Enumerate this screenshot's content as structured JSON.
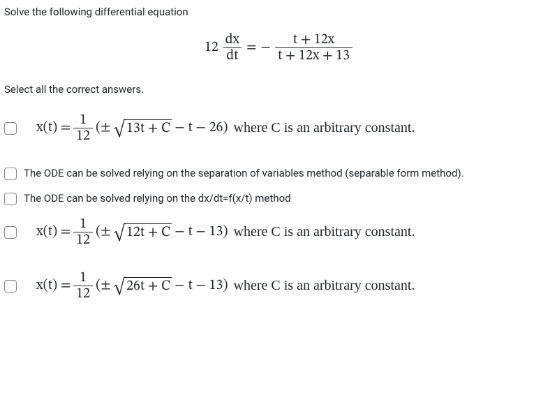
{
  "prompt": "Solve the following differential equation",
  "equation": {
    "lhs_coeff": "12",
    "lhs_num": "dx",
    "lhs_den": "dt",
    "eq": "=",
    "rhs_sign": "−",
    "rhs_num": "t + 12x",
    "rhs_den": "t + 12x + 13"
  },
  "instruction": "Select all the correct answers.",
  "options": [
    {
      "type": "math",
      "lhs": "x(t) =",
      "frac_num": "1",
      "frac_den": "12",
      "open": "(±",
      "sqrt_arg": "13t + C",
      "tail": " − t − 26)",
      "where": " where C is an arbitrary constant."
    },
    {
      "type": "text",
      "text": "The ODE can be solved relying on the separation of variables method (separable form method)."
    },
    {
      "type": "text",
      "text": "The ODE can be solved relying on the dx/dt=f(x/t) method"
    },
    {
      "type": "math",
      "lhs": "x(t) =",
      "frac_num": "1",
      "frac_den": "12",
      "open": "(±",
      "sqrt_arg": "12t + C",
      "tail": " − t − 13)",
      "where": " where C is an arbitrary constant."
    },
    {
      "type": "math",
      "lhs": "x(t) =",
      "frac_num": "1",
      "frac_den": "12",
      "open": "(±",
      "sqrt_arg": "26t + C",
      "tail": " − t − 13)",
      "where": " where C is an arbitrary constant."
    }
  ]
}
